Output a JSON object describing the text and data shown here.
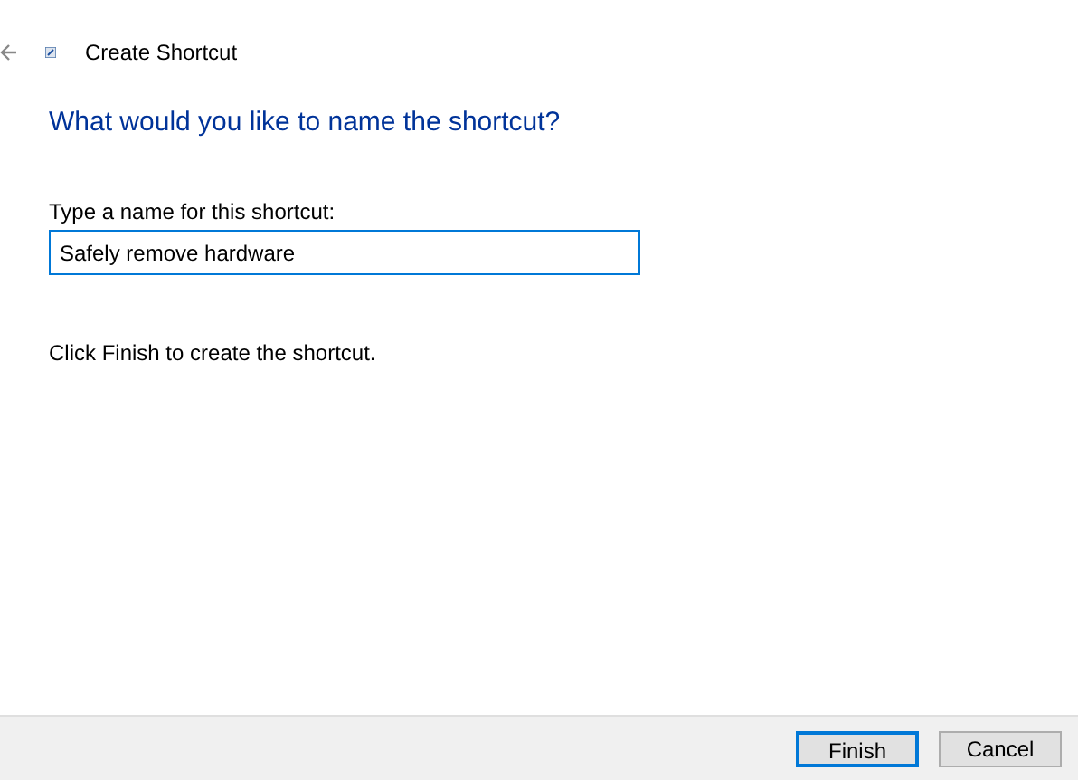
{
  "window": {
    "title": "Create Shortcut"
  },
  "heading": "What would you like to name the shortcut?",
  "name_field": {
    "label": "Type a name for this shortcut:",
    "value": "Safely remove hardware"
  },
  "instruction": "Click Finish to create the shortcut.",
  "buttons": [
    {
      "label": "Finish",
      "focused": true
    },
    {
      "label": "Cancel",
      "focused": false
    }
  ]
}
